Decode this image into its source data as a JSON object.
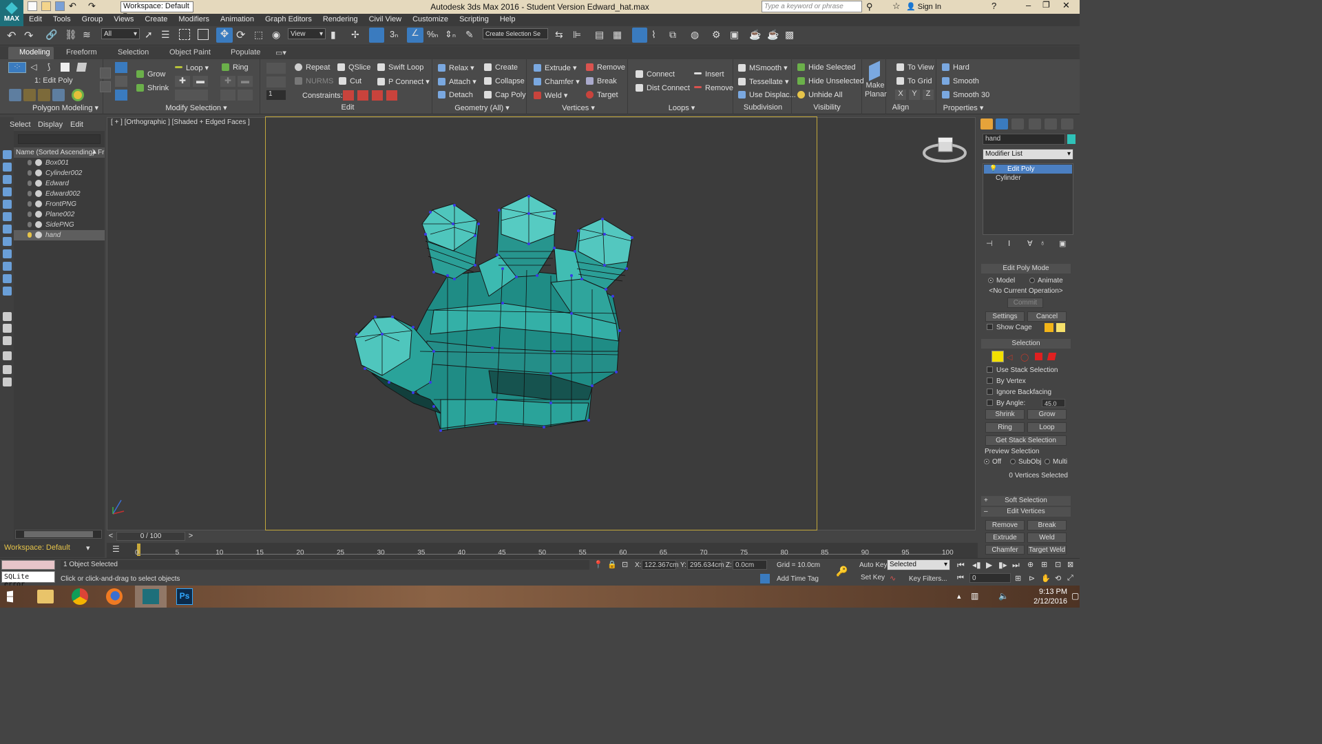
{
  "app": {
    "title": "Autodesk 3ds Max 2016 - Student Version    Edward_hat.max",
    "logo_label": "MAX",
    "workspace": "Workspace: Default",
    "search_placeholder": "Type a keyword or phrase",
    "sign_in": "Sign In"
  },
  "menu": [
    "Edit",
    "Tools",
    "Group",
    "Views",
    "Create",
    "Modifiers",
    "Animation",
    "Graph Editors",
    "Rendering",
    "Civil View",
    "Customize",
    "Scripting",
    "Help"
  ],
  "toolbar": {
    "filter_value": "All",
    "ref_coord_value": "View",
    "selection_set_placeholder": "Create Selection Se"
  },
  "ribbon": {
    "tabs": [
      "Modeling",
      "Freeform",
      "Selection",
      "Object Paint",
      "Populate"
    ],
    "active_tab": "Modeling",
    "edit_poly_label": "1: Edit Poly",
    "groups": {
      "polygon_modeling": "Polygon Modeling",
      "modify_selection": "Modify Selection",
      "edit": "Edit",
      "geometry": "Geometry (All)",
      "vertices": "Vertices",
      "loops": "Loops",
      "subdivision": "Subdivision",
      "visibility": "Visibility",
      "align": "Align",
      "properties": "Properties"
    },
    "modify_selection": {
      "grow": "Grow",
      "shrink": "Shrink",
      "loop": "Loop",
      "ring": "Ring"
    },
    "edit": {
      "repeat": "Repeat",
      "qslice": "QSlice",
      "swift_loop": "Swift Loop",
      "nurms": "NURMS",
      "cut": "Cut",
      "p_connect": "P Connect",
      "constraints": "Constraints:"
    },
    "geometry": {
      "relax": "Relax",
      "create": "Create",
      "attach": "Attach",
      "collapse": "Collapse",
      "detach": "Detach",
      "cap_poly": "Cap Poly"
    },
    "vertices": {
      "extrude": "Extrude",
      "remove": "Remove",
      "chamfer": "Chamfer",
      "break": "Break",
      "weld": "Weld",
      "target": "Target"
    },
    "loops": {
      "connect": "Connect",
      "insert": "Insert",
      "dist_connect": "Dist Connect",
      "remove": "Remove"
    },
    "subdivision": {
      "msmooth": "MSmooth",
      "tessellate": "Tessellate",
      "use_displac": "Use Displac..."
    },
    "visibility": {
      "hide_selected": "Hide Selected",
      "hide_unselected": "Hide Unselected",
      "unhide_all": "Unhide All"
    },
    "make_planar": "Make Planar",
    "align": {
      "to_view": "To View",
      "to_grid": "To Grid",
      "x": "X",
      "y": "Y",
      "z": "Z"
    },
    "properties": {
      "hard": "Hard",
      "smooth": "Smooth",
      "smooth30": "Smooth 30"
    }
  },
  "scene_explorer": {
    "menu": [
      "Select",
      "Display",
      "Edit"
    ],
    "column_header": "Name (Sorted Ascending)",
    "column_header2": "Fr",
    "items": [
      {
        "name": "Box001"
      },
      {
        "name": "Cylinder002"
      },
      {
        "name": "Edward"
      },
      {
        "name": "Edward002"
      },
      {
        "name": "FrontPNG"
      },
      {
        "name": "Plane002"
      },
      {
        "name": "SidePNG"
      },
      {
        "name": "hand"
      }
    ],
    "selected": "hand",
    "workspace_footer": "Workspace: Default"
  },
  "viewport": {
    "label": "[ + ] [Orthographic ] [Shaded + Edged Faces ]",
    "mesh_color": "#2ea79f",
    "vertex_color": "#3a3ae8",
    "safe_frame_color": "#c3a83c"
  },
  "command_panel": {
    "object_name": "hand",
    "modifier_list": "Modifier List",
    "stack": [
      "Edit Poly",
      "Cylinder"
    ],
    "edit_poly_mode": {
      "title": "Edit Poly Mode",
      "model": "Model",
      "animate": "Animate",
      "current_op": "<No Current Operation>",
      "commit": "Commit",
      "settings": "Settings",
      "cancel": "Cancel",
      "show_cage": "Show Cage"
    },
    "selection": {
      "title": "Selection",
      "use_stack": "Use Stack Selection",
      "by_vertex": "By Vertex",
      "ignore_backfacing": "Ignore Backfacing",
      "by_angle": "By Angle:",
      "angle_value": "45.0",
      "shrink": "Shrink",
      "grow": "Grow",
      "ring": "Ring",
      "loop": "Loop",
      "get_stack": "Get Stack Selection",
      "preview": "Preview Selection",
      "off": "Off",
      "subobj": "SubObj",
      "multi": "Multi",
      "count": "0 Vertices Selected"
    },
    "soft_selection": "Soft Selection",
    "edit_vertices": {
      "title": "Edit Vertices",
      "remove": "Remove",
      "break": "Break",
      "extrude": "Extrude",
      "weld": "Weld",
      "chamfer": "Chamfer",
      "target_weld": "Target Weld"
    }
  },
  "timeline": {
    "frame": "0 / 100",
    "ticks": [
      "0",
      "5",
      "10",
      "15",
      "20",
      "25",
      "30",
      "35",
      "40",
      "45",
      "50",
      "55",
      "60",
      "65",
      "70",
      "75",
      "80",
      "85",
      "90",
      "95",
      "100"
    ]
  },
  "status": {
    "objects": "1 Object Selected",
    "prompt": "Click or click-and-drag to select objects",
    "sqlite": "SQLite error",
    "x": "122.367cm",
    "y": "295.634cm",
    "z": "0.0cm",
    "x_label": "X:",
    "y_label": "Y:",
    "z_label": "Z:",
    "grid": "Grid = 10.0cm",
    "auto_key": "Auto Key",
    "set_key": "Set Key",
    "selected": "Selected",
    "key_filters": "Key Filters...",
    "add_time_tag": "Add Time Tag",
    "frame_field": "0"
  },
  "taskbar": {
    "time": "9:13 PM",
    "date": "2/12/2016",
    "apps": [
      "windows-start",
      "file-explorer",
      "chrome",
      "firefox",
      "3dsmax",
      "photoshop"
    ]
  }
}
